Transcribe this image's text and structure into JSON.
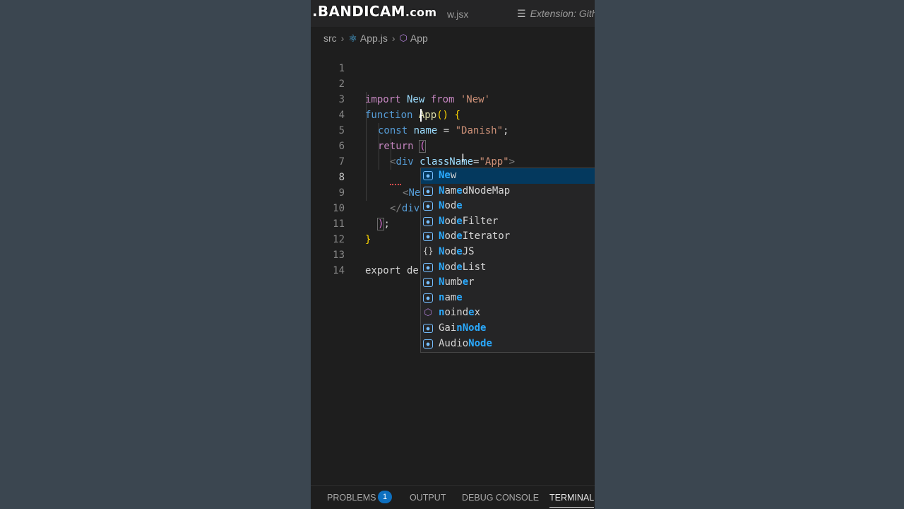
{
  "watermark": {
    "main": ".BANDICAM",
    "suffix": ".com"
  },
  "tabs": [
    {
      "label": "w.jsx"
    },
    {
      "label": "Extension: Gith"
    }
  ],
  "breadcrumb": {
    "folder": "src",
    "file": "App.js",
    "symbol": "App"
  },
  "code": {
    "line_numbers": [
      "1",
      "2",
      "3",
      "4",
      "5",
      "6",
      "7",
      "8",
      "9",
      "10",
      "11",
      "12",
      "13",
      "14"
    ],
    "l2": {
      "k1": "import",
      "id": " New ",
      "k2": "from",
      "s": " 'New'"
    },
    "l3": {
      "k": "function",
      "fn": " App",
      "b": "()",
      "sp": " ",
      "br": "{"
    },
    "l4": {
      "k": "const",
      "v": " name",
      "eq": " = ",
      "s": "\"Danish\"",
      "semi": ";"
    },
    "l5": {
      "k": "return",
      "sp": " ",
      "p": "("
    },
    "l6": {
      "lt": "<",
      "tag": "div",
      "attr": " className",
      "eq": "=",
      "s": "\"App\"",
      "gt": ">"
    },
    "l8": {
      "lt": "<",
      "typed": "Ne"
    },
    "l9": {
      "lt": "</",
      "tag": "div"
    },
    "l10": {
      "p": ")",
      "semi": ";"
    },
    "l11": {
      "br": "}"
    },
    "l13": {
      "k": "export",
      "rest": " de"
    }
  },
  "suggestions": [
    {
      "match": "Ne",
      "rest": "w",
      "kind": "variable"
    },
    {
      "match": "N",
      "rest": "am",
      "match2": "e",
      "rest2": "dNodeMap",
      "kind": "variable"
    },
    {
      "match": "N",
      "rest": "od",
      "match2": "e",
      "rest2": "",
      "kind": "variable"
    },
    {
      "match": "N",
      "rest": "od",
      "match2": "e",
      "rest2": "Filter",
      "kind": "variable"
    },
    {
      "match": "N",
      "rest": "od",
      "match2": "e",
      "rest2": "Iterator",
      "kind": "variable"
    },
    {
      "match": "N",
      "rest": "od",
      "match2": "e",
      "rest2": "JS",
      "kind": "namespace"
    },
    {
      "match": "N",
      "rest": "od",
      "match2": "e",
      "rest2": "List",
      "kind": "variable"
    },
    {
      "match": "N",
      "rest": "umb",
      "match2": "e",
      "rest2": "r",
      "kind": "variable"
    },
    {
      "match": "n",
      "rest": "am",
      "match2": "e",
      "rest2": "",
      "kind": "variable"
    },
    {
      "match": "n",
      "rest": "oind",
      "match2": "e",
      "rest2": "x",
      "kind": "property"
    },
    {
      "match": "",
      "rest": "Gai",
      "match2": "nNode",
      "rest2": "",
      "kind": "variable"
    },
    {
      "match": "",
      "rest": "Audio",
      "match2": "Node",
      "rest2": "",
      "kind": "variable"
    }
  ],
  "panel": {
    "problems": "PROBLEMS",
    "problems_count": "1",
    "output": "OUTPUT",
    "debug": "DEBUG CONSOLE",
    "terminal": "TERMINAL"
  },
  "colors": {
    "editor_bg": "#1e1e1e",
    "accent": "#2aaaff",
    "badge": "#0e70c0"
  }
}
